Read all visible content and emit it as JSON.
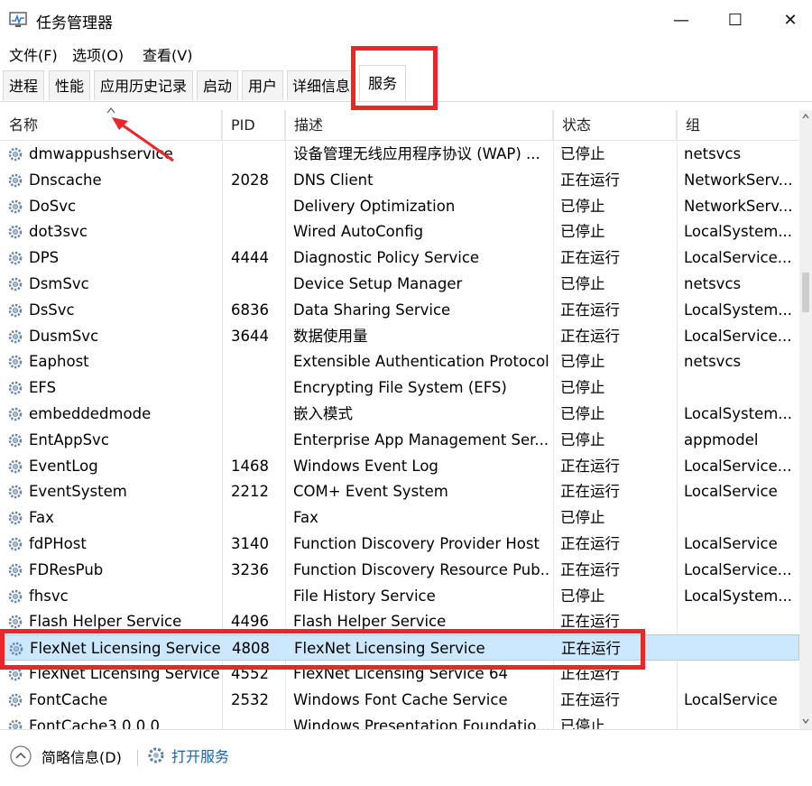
{
  "window": {
    "title": "任务管理器",
    "minimize_icon": "—",
    "maximize_icon": "☐",
    "close_icon": "✕"
  },
  "menu": [
    {
      "label": "文件(F)"
    },
    {
      "label": "选项(O)"
    },
    {
      "label": "查看(V)"
    }
  ],
  "tabs": [
    {
      "label": "进程"
    },
    {
      "label": "性能"
    },
    {
      "label": "应用历史记录"
    },
    {
      "label": "启动"
    },
    {
      "label": "用户"
    },
    {
      "label": "详细信息"
    },
    {
      "label": "服务",
      "active": true
    }
  ],
  "columns": {
    "name": "名称",
    "pid": "PID",
    "desc": "描述",
    "status": "状态",
    "group": "组"
  },
  "rows": [
    {
      "name": "dmwappushservice",
      "pid": "",
      "desc": "设备管理无线应用程序协议 (WAP) ...",
      "status": "已停止",
      "group": "netsvcs"
    },
    {
      "name": "Dnscache",
      "pid": "2028",
      "desc": "DNS Client",
      "status": "正在运行",
      "group": "NetworkServ..."
    },
    {
      "name": "DoSvc",
      "pid": "",
      "desc": "Delivery Optimization",
      "status": "已停止",
      "group": "NetworkServ..."
    },
    {
      "name": "dot3svc",
      "pid": "",
      "desc": "Wired AutoConfig",
      "status": "已停止",
      "group": "LocalSystem..."
    },
    {
      "name": "DPS",
      "pid": "4444",
      "desc": "Diagnostic Policy Service",
      "status": "正在运行",
      "group": "LocalService..."
    },
    {
      "name": "DsmSvc",
      "pid": "",
      "desc": "Device Setup Manager",
      "status": "已停止",
      "group": "netsvcs"
    },
    {
      "name": "DsSvc",
      "pid": "6836",
      "desc": "Data Sharing Service",
      "status": "正在运行",
      "group": "LocalSystem..."
    },
    {
      "name": "DusmSvc",
      "pid": "3644",
      "desc": "数据使用量",
      "status": "正在运行",
      "group": "LocalService..."
    },
    {
      "name": "Eaphost",
      "pid": "",
      "desc": "Extensible Authentication Protocol",
      "status": "已停止",
      "group": "netsvcs"
    },
    {
      "name": "EFS",
      "pid": "",
      "desc": "Encrypting File System (EFS)",
      "status": "已停止",
      "group": ""
    },
    {
      "name": "embeddedmode",
      "pid": "",
      "desc": "嵌入模式",
      "status": "已停止",
      "group": "LocalSystem..."
    },
    {
      "name": "EntAppSvc",
      "pid": "",
      "desc": "Enterprise App Management Ser...",
      "status": "已停止",
      "group": "appmodel"
    },
    {
      "name": "EventLog",
      "pid": "1468",
      "desc": "Windows Event Log",
      "status": "正在运行",
      "group": "LocalService..."
    },
    {
      "name": "EventSystem",
      "pid": "2212",
      "desc": "COM+ Event System",
      "status": "正在运行",
      "group": "LocalService"
    },
    {
      "name": "Fax",
      "pid": "",
      "desc": "Fax",
      "status": "已停止",
      "group": ""
    },
    {
      "name": "fdPHost",
      "pid": "3140",
      "desc": "Function Discovery Provider Host",
      "status": "正在运行",
      "group": "LocalService"
    },
    {
      "name": "FDResPub",
      "pid": "3236",
      "desc": "Function Discovery Resource Pub...",
      "status": "正在运行",
      "group": "LocalService..."
    },
    {
      "name": "fhsvc",
      "pid": "",
      "desc": "File History Service",
      "status": "已停止",
      "group": "LocalSystem..."
    },
    {
      "name": "Flash Helper Service",
      "pid": "4496",
      "desc": "Flash Helper Service",
      "status": "正在运行",
      "group": ""
    },
    {
      "name": "FlexNet Licensing Service",
      "pid": "4808",
      "desc": "FlexNet Licensing Service",
      "status": "正在运行",
      "group": "",
      "selected": true
    },
    {
      "name": "FlexNet Licensing Service...",
      "pid": "4552",
      "desc": "FlexNet Licensing Service 64",
      "status": "正在运行",
      "group": ""
    },
    {
      "name": "FontCache",
      "pid": "2532",
      "desc": "Windows Font Cache Service",
      "status": "正在运行",
      "group": "LocalService"
    },
    {
      "name": "FontCache3.0.0.0",
      "pid": "",
      "desc": "Windows Presentation Foundatio...",
      "status": "已停止",
      "group": ""
    }
  ],
  "statusbar": {
    "fewer_details": "简略信息(D)",
    "open_services": "打开服务"
  },
  "colors": {
    "selected_row": "#cce8ff",
    "annotation_red": "#e8262b",
    "link_blue": "#1a5fb4"
  }
}
